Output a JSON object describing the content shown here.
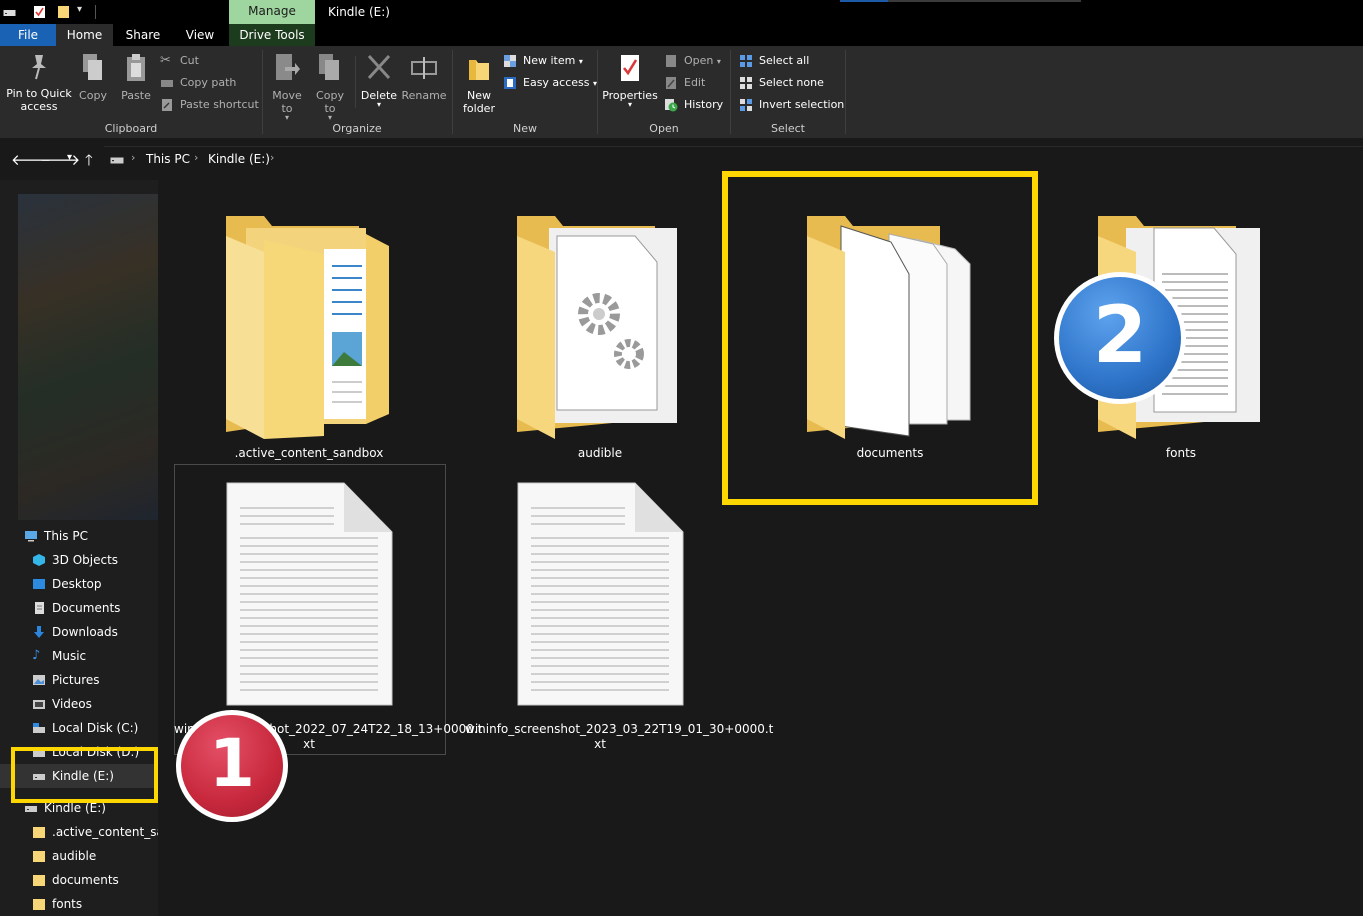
{
  "window": {
    "title": "Kindle (E:)",
    "context_tab": "Manage"
  },
  "ribbon_tabs": [
    "File",
    "Home",
    "Share",
    "View",
    "Drive Tools"
  ],
  "ribbon": {
    "clipboard": {
      "label": "Clipboard",
      "pin": "Pin to Quick access",
      "copy": "Copy",
      "paste": "Paste",
      "cut": "Cut",
      "copy_path": "Copy path",
      "paste_shortcut": "Paste shortcut"
    },
    "organize": {
      "label": "Organize",
      "move_to": "Move to",
      "copy_to": "Copy to",
      "delete": "Delete",
      "rename": "Rename"
    },
    "new": {
      "label": "New",
      "new_folder": "New folder",
      "new_item": "New item",
      "easy_access": "Easy access"
    },
    "open": {
      "label": "Open",
      "properties": "Properties",
      "open": "Open",
      "edit": "Edit",
      "history": "History"
    },
    "select": {
      "label": "Select",
      "select_all": "Select all",
      "select_none": "Select none",
      "invert": "Invert selection"
    }
  },
  "breadcrumb": [
    "This PC",
    "Kindle (E:)"
  ],
  "nav_tree": {
    "this_pc": "This PC",
    "children": [
      {
        "label": "3D Objects",
        "icon": "3d-objects-icon"
      },
      {
        "label": "Desktop",
        "icon": "desktop-icon"
      },
      {
        "label": "Documents",
        "icon": "documents-icon"
      },
      {
        "label": "Downloads",
        "icon": "downloads-icon"
      },
      {
        "label": "Music",
        "icon": "music-icon"
      },
      {
        "label": "Pictures",
        "icon": "pictures-icon"
      },
      {
        "label": "Videos",
        "icon": "videos-icon"
      },
      {
        "label": "Local Disk (C:)",
        "icon": "drive-icon"
      },
      {
        "label": "Local Disk (D:)",
        "icon": "drive-icon"
      },
      {
        "label": "Kindle (E:)",
        "icon": "drive-icon"
      }
    ],
    "kindle_root": "Kindle (E:)",
    "kindle_children": [
      ".active_content_san",
      "audible",
      "documents",
      "fonts"
    ]
  },
  "items": [
    {
      "name": ".active_content_sandbox",
      "type": "folder"
    },
    {
      "name": "audible",
      "type": "folder"
    },
    {
      "name": "documents",
      "type": "folder"
    },
    {
      "name": "fonts",
      "type": "folder"
    },
    {
      "name": "wininfo_screenshot_2022_07_24T22_18_13+0000.txt",
      "type": "text-file"
    },
    {
      "name": "wininfo_screenshot_2023_03_22T19_01_30+0000.txt",
      "type": "text-file"
    }
  ],
  "item_labels": {
    "file1_line1": "wininfo_screenshot_2022_07_24T22_18_13+0000.t",
    "file1_line2": "xt",
    "file2_line1": "wininfo_screenshot_2023_03_22T19_01_30+0000.t",
    "file2_line2": "xt"
  },
  "annotations": [
    {
      "number": "1",
      "color": "#c8283c"
    },
    {
      "number": "2",
      "color": "#2e74c9"
    }
  ],
  "colors": {
    "highlight": "#ffd700",
    "folder": "#f6d676",
    "file_tab": "#1a62b4"
  }
}
